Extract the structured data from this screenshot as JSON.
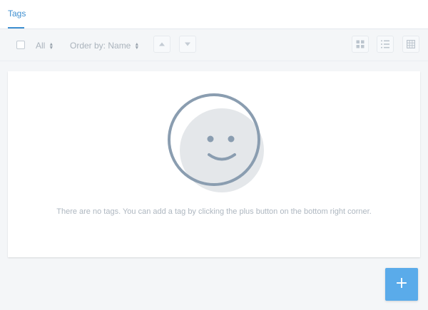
{
  "tabs": [
    {
      "label": "Tags",
      "active": true
    }
  ],
  "toolbar": {
    "filter_value": "All",
    "order_by_value": "Order by: Name",
    "sort_ascending_icon": "caret-up-icon",
    "sort_descending_icon": "caret-down-icon",
    "view_icons": [
      "grid-view-icon",
      "list-view-icon",
      "table-view-icon"
    ]
  },
  "empty_state": {
    "illustration_icon": "smiley-face-icon",
    "message": "There are no tags. You can add a tag by clicking the plus button on the bottom right corner."
  },
  "fab": {
    "icon": "plus-icon",
    "label": "+"
  },
  "colors": {
    "accent": "#3f8fd0",
    "fab": "#5aabea",
    "illustration_stroke": "#8a9db0",
    "illustration_fill": "#e4e7ea"
  }
}
